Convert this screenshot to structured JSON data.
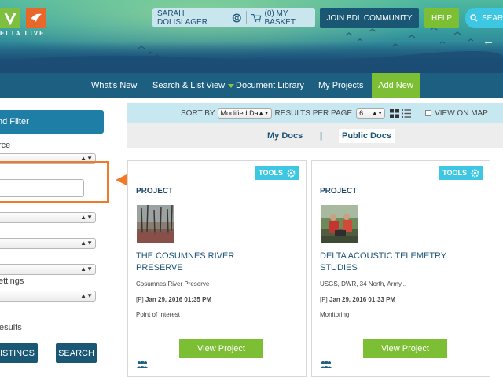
{
  "header": {
    "logo_text": "ELTA LIVE",
    "user_name": "SARAH DOLISLAGER",
    "basket": "(0) MY BASKET",
    "join_label": "JOIN BDL COMMUNITY",
    "help_label": "HELP",
    "search_label": "SEAR",
    "back_icon": "back-arrow-icon"
  },
  "nav": {
    "items": [
      "What's New",
      "Search & List View",
      "Document Library",
      "My Projects"
    ],
    "add_new": "Add New"
  },
  "filter": {
    "tab_label": "nd Filter",
    "source_label": "rce",
    "settings_label": "ettings",
    "results_label": "esults",
    "listings_button": "ISTINGS",
    "search_button": "SEARCH"
  },
  "sortbar": {
    "sort_by_label": "SORT BY",
    "sort_value": "Modified Da",
    "results_label": "RESULTS PER PAGE",
    "results_value": "6",
    "view_on_map": "VIEW ON MAP"
  },
  "docs": {
    "my_docs": "My Docs",
    "separator": "|",
    "public_docs": "Public Docs"
  },
  "cards": [
    {
      "tools": "TOOLS",
      "type": "PROJECT",
      "title": "THE COSUMNES RIVER PRESERVE",
      "subtitle": "Cosumnes River Preserve",
      "date_prefix": "[P]",
      "date": "Jan 29, 2016 01:35 PM",
      "kind": "Point of Interest",
      "button": "View Project"
    },
    {
      "tools": "TOOLS",
      "type": "PROJECT",
      "title": "DELTA ACOUSTIC TELEMETRY STUDIES",
      "subtitle": "USGS, DWR, 34 North, Army...",
      "date_prefix": "[P]",
      "date": "Jan 29, 2016 01:33 PM",
      "kind": "Monitoring",
      "button": "View Project"
    }
  ],
  "colors": {
    "nav_bg": "#1d5f80",
    "accent_green": "#7dbf34",
    "accent_cyan": "#3ec7e2",
    "dark_blue": "#1a5775",
    "highlight_orange": "#f07a25"
  }
}
